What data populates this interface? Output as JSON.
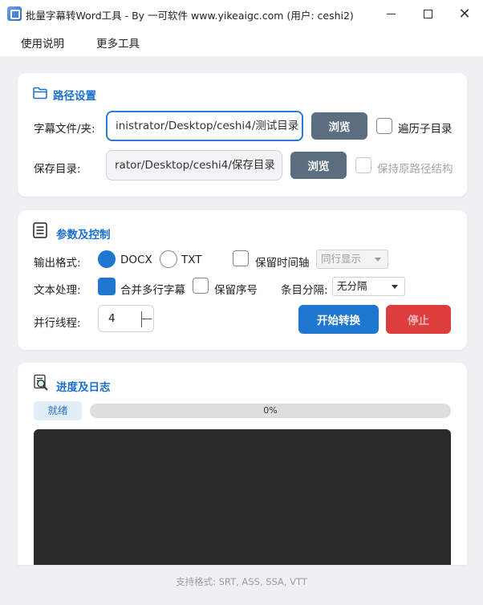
{
  "window": {
    "title": "批量字幕转Word工具 - By 一可软件 www.yikeaigc.com (用户: ceshi2)",
    "min_icon": "minimize-icon",
    "max_icon": "maximize-icon",
    "close_icon": "close-icon",
    "close_glyph": "✕"
  },
  "menu": {
    "items": [
      {
        "label": "使用说明"
      },
      {
        "label": "更多工具"
      }
    ]
  },
  "path_section": {
    "title": "路径设置",
    "icon": "folder-icon",
    "subtitle_file_label": "字幕文件/夹:",
    "subtitle_path": "inistrator/Desktop/ceshi4/测试目录",
    "browse_label": "浏览",
    "recursive_label": "遍历子目录",
    "recursive_checked": false,
    "save_label": "保存目录:",
    "save_path": "rator/Desktop/ceshi4/保存目录",
    "browse2_label": "浏览",
    "keep_structure_label": "保持原路径结构",
    "keep_structure_checked": false,
    "keep_structure_enabled": false
  },
  "params_section": {
    "title": "参数及控制",
    "icon": "document-list-icon",
    "format_label": "输出格式:",
    "format_options": [
      "DOCX",
      "TXT"
    ],
    "format_selected": "DOCX",
    "keep_timeline_label": "保留时间轴",
    "keep_timeline_checked": false,
    "timeline_select_value": "同行显示",
    "text_processing_label": "文本处理:",
    "merge_lines_label": "合并多行字幕",
    "merge_lines_checked": true,
    "keep_index_label": "保留序号",
    "keep_index_checked": false,
    "separator_label": "条目分隔:",
    "separator_value": "无分隔",
    "threads_label": "并行线程:",
    "threads_value": "4",
    "start_label": "开始转换",
    "stop_label": "停止",
    "accent": "#1f77d0",
    "stop_color": "#dc3d3d"
  },
  "progress_section": {
    "title": "进度及日志",
    "icon": "log-search-icon",
    "status": "就绪",
    "progress_value": 0,
    "progress_text": "0%"
  },
  "footer": {
    "supported_formats": "支持格式: SRT, ASS, SSA, VTT"
  }
}
